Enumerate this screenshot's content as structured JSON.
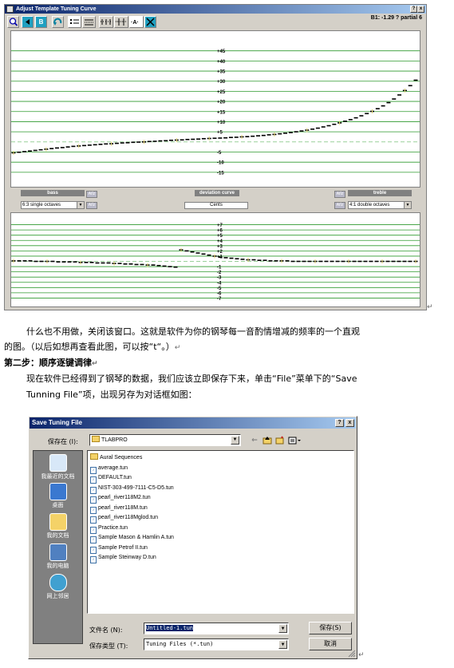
{
  "tuning_window": {
    "title": "Adjust Template Tuning Curve",
    "status": "B1: -1.29 ? partial 6",
    "titlebar_buttons": [
      "?",
      "x"
    ],
    "toolbar_icons": [
      "zoom-icon",
      "arrow-left-icon",
      "b-icon",
      "refresh-icon",
      "list-icon",
      "grid-icon",
      "dots-icon",
      "curve-icon",
      "close-icon"
    ],
    "bass_label": "bass",
    "treble_label": "treble",
    "deviation_label": "deviation curve",
    "cents_label": "Cents",
    "aiz_label": "Aíİz",
    "bass_select": "6:3 single octaves",
    "treble_select": "4:1 double octaves",
    "colors": {
      "grid": "#2e9a2e",
      "curve": "#000000",
      "highlight": "#e8d870",
      "zero": "#9ad09a"
    }
  },
  "chart_data": [
    {
      "type": "line",
      "title": "",
      "y_ticks": [
        "+45",
        "+40",
        "+35",
        "+30",
        "+25",
        "+20",
        "+15",
        "+10",
        "+5",
        "-5",
        "-10",
        "-15"
      ],
      "ylim": [
        -19,
        50
      ],
      "x_count": 88,
      "values": [
        -5.4,
        -5.1,
        -4.8,
        -4.5,
        -4.2,
        -3.9,
        -3.6,
        -3.3,
        -3.0,
        -2.8,
        -2.5,
        -2.2,
        -2.0,
        -1.8,
        -1.6,
        -1.4,
        -1.2,
        -1.0,
        -0.9,
        -0.7,
        -0.5,
        -0.4,
        -0.2,
        -0.1,
        0.0,
        0.2,
        0.3,
        0.5,
        0.6,
        0.8,
        0.9,
        1.0,
        1.2,
        1.3,
        1.4,
        1.6,
        1.7,
        1.8,
        1.9,
        2.0,
        2.2,
        2.3,
        2.5,
        2.6,
        2.8,
        3.0,
        3.2,
        3.5,
        3.7,
        4.0,
        4.3,
        4.6,
        5.0,
        5.4,
        5.8,
        6.3,
        6.8,
        7.4,
        8.0,
        8.7,
        9.4,
        10.2,
        11.0,
        11.9,
        12.9,
        14.0,
        15.1,
        16.4,
        17.8,
        19.4,
        21.2,
        23.2,
        25.4,
        27.8,
        30.5
      ]
    },
    {
      "type": "line",
      "title": "",
      "y_ticks": [
        "+7",
        "+6",
        "+5",
        "+4",
        "+3",
        "+2",
        "+1",
        "-1",
        "-2",
        "-3",
        "-4",
        "-5",
        "-6",
        "-7"
      ],
      "ylim": [
        -8,
        8
      ],
      "segments": [
        {
          "x_start": 0,
          "values": [
            0.1,
            0.1,
            0.1,
            0.1,
            0.0,
            0.0,
            0.0,
            0.0,
            -0.1,
            -0.1,
            -0.1,
            -0.1,
            -0.2,
            -0.2,
            -0.2,
            -0.3,
            -0.3,
            -0.3,
            -0.4,
            -0.4,
            -0.5,
            -0.5,
            -0.6,
            -0.6,
            -0.7,
            -0.7,
            -0.8,
            -0.9,
            -1.0,
            -1.1
          ]
        },
        {
          "x_start": 30,
          "values": [
            2.2,
            2.0,
            1.8,
            1.6,
            1.4,
            1.2,
            1.0,
            0.8,
            0.7,
            0.6,
            0.5,
            0.4,
            0.3,
            0.3,
            0.2,
            0.2,
            0.1,
            0.1,
            0.1,
            0.1,
            0.0,
            0.0,
            0.0,
            0.0,
            0.0,
            0.0,
            0.0,
            0.0,
            0.0,
            0.0,
            0.0,
            0.0,
            0.0,
            0.0,
            0.0,
            0.0,
            0.0,
            0.0,
            0.0,
            0.0,
            0.0,
            0.0,
            0.0
          ]
        }
      ]
    }
  ],
  "doc": {
    "para1_line1": "什么也不用做，关闭该窗口。这就是软件为你的钢琴每一音酌情增减的频率的一个直观",
    "para1_line2": "的图。（以后如想再查看此图，可以按“t“。）",
    "step2": "第二步：顺序逐键调律",
    "para2_line1": "现在软件已经得到了钢琴的数据，我们应该立即保存下来，单击“File”菜单下的“Save",
    "para2_line2": "Tunning File”项，出现另存为对话框如图：",
    "pilcrow": "↵"
  },
  "save_dialog": {
    "title": "Save Tuning File",
    "help_button": "?",
    "close_button": "x",
    "save_in_label": "保存在 (I):",
    "save_in_value": "TLABPRO",
    "places": [
      "我最近的文档",
      "桌面",
      "我的文档",
      "我的电脑",
      "网上邻居"
    ],
    "files": [
      {
        "name": "Aural Sequences",
        "folder": true
      },
      {
        "name": "average.tun",
        "folder": false
      },
      {
        "name": "DEFAULT.tun",
        "folder": false
      },
      {
        "name": "NIST-303-499-7111-C5-D5.tun",
        "folder": false
      },
      {
        "name": "pearl_river118M2.tun",
        "folder": false
      },
      {
        "name": "pearl_river118M.tun",
        "folder": false
      },
      {
        "name": "pearl_river118Mglod.tun",
        "folder": false
      },
      {
        "name": "Practice.tun",
        "folder": false
      },
      {
        "name": "Sample Mason & Hamlin A.tun",
        "folder": false
      },
      {
        "name": "Sample Petrof II.tun",
        "folder": false
      },
      {
        "name": "Sample Steinway D.tun",
        "folder": false
      }
    ],
    "filename_label": "文件名 (N):",
    "filename_value": "Untitled-1.tun",
    "filetype_label": "保存类型 (T):",
    "filetype_value": "Tuning Files (*.tun)",
    "save_button": "保存(S)",
    "cancel_button": "取消"
  }
}
